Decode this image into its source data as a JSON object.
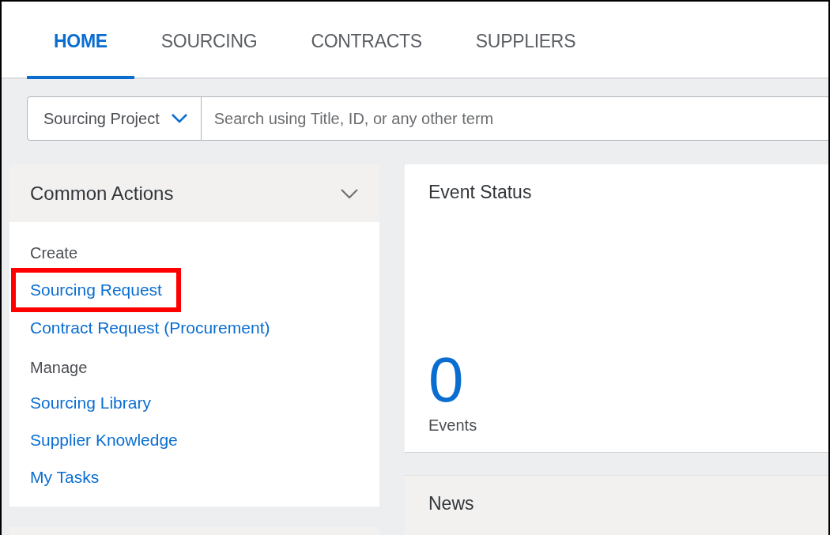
{
  "tabs": [
    {
      "label": "HOME",
      "selected": true
    },
    {
      "label": "SOURCING",
      "selected": false
    },
    {
      "label": "CONTRACTS",
      "selected": false
    },
    {
      "label": "SUPPLIERS",
      "selected": false
    }
  ],
  "search": {
    "scope": "Sourcing Project",
    "placeholder": "Search using Title, ID, or any other term"
  },
  "common_actions": {
    "title": "Common Actions",
    "expanded": true,
    "items": [
      {
        "kind": "heading",
        "label": "Create"
      },
      {
        "kind": "link",
        "label": "Sourcing Request",
        "highlighted": true
      },
      {
        "kind": "link",
        "label": "Contract Request (Procurement)",
        "highlighted": false
      },
      {
        "kind": "heading",
        "label": "Manage"
      },
      {
        "kind": "link",
        "label": "Sourcing Library",
        "highlighted": false
      },
      {
        "kind": "link",
        "label": "Supplier Knowledge",
        "highlighted": false
      },
      {
        "kind": "link",
        "label": "My Tasks",
        "highlighted": false
      }
    ]
  },
  "event_status": {
    "title": "Event Status",
    "count": "0",
    "caption": "Events"
  },
  "news": {
    "title": "News"
  }
}
